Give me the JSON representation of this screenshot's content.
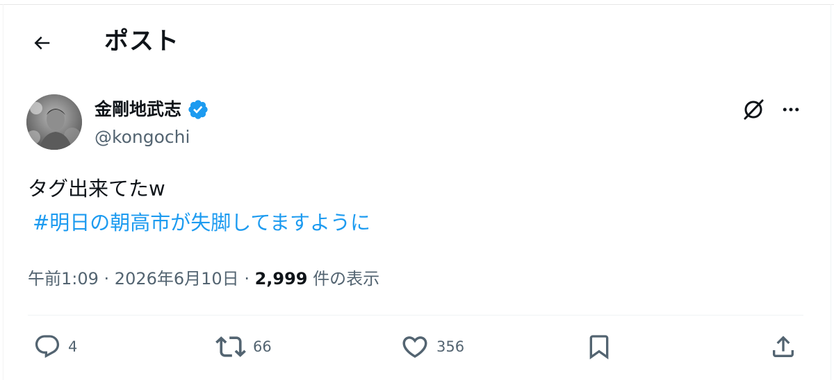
{
  "header": {
    "title": "ポスト",
    "back_icon": "arrow-left-icon"
  },
  "author": {
    "display_name": "金剛地武志",
    "handle": "@kongochi",
    "verified_icon": "verified-badge-icon",
    "verified_color": "#1d9bf0"
  },
  "top_actions": {
    "grok_icon": "grok-icon",
    "more_icon": "more-horizontal-icon"
  },
  "tweet": {
    "text": "タグ出来てたw",
    "hashtag": "#明日の朝高市が失脚してますように",
    "hashtag_color": "#1d9bf0"
  },
  "meta": {
    "time": "午前1:09",
    "separator": " · ",
    "date": "2026年6月10日",
    "views_count": "2,999",
    "views_label": "件の表示"
  },
  "actions": {
    "reply": {
      "icon": "reply-icon",
      "count": "4"
    },
    "retweet": {
      "icon": "retweet-icon",
      "count": "66"
    },
    "like": {
      "icon": "heart-icon",
      "count": "356"
    },
    "bookmark": {
      "icon": "bookmark-icon"
    },
    "share": {
      "icon": "share-icon"
    }
  },
  "colors": {
    "text_primary": "#0f1419",
    "text_secondary": "#536471",
    "accent": "#1d9bf0"
  }
}
